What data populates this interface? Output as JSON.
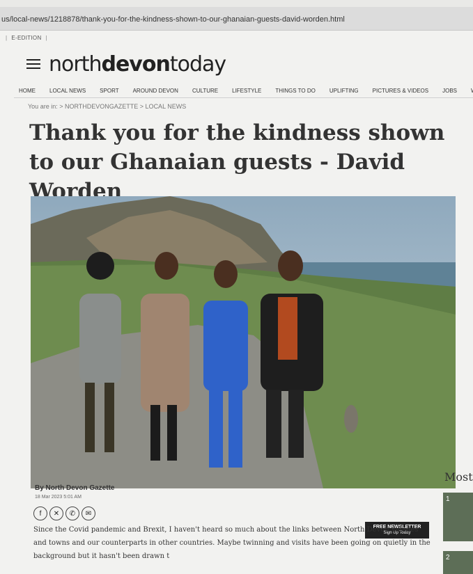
{
  "browser": {
    "url": "us/local-news/1218878/thank-you-for-the-kindness-shown-to-our-ghanaian-guests-david-worden.html"
  },
  "site": {
    "edition_label": "E-EDITION",
    "logo_light_1": "north",
    "logo_bold": "devon",
    "logo_light_2": "today"
  },
  "nav": {
    "items": [
      "HOME",
      "LOCAL NEWS",
      "SPORT",
      "AROUND DEVON",
      "CULTURE",
      "LIFESTYLE",
      "THINGS TO DO",
      "UPLIFTING",
      "PICTURES & VIDEOS",
      "JOBS",
      "WI"
    ]
  },
  "breadcrumb": "You are in: > NORTHDEVONGAZETTE > LOCAL NEWS",
  "article": {
    "headline": "Thank you for the kindness shown to our Ghanaian guests - David Worden",
    "byline": "By North Devon Gazette",
    "date": "18 Mar 2023 5:01 AM",
    "body": "Since the Covid pandemic and Brexit, I haven't heard so much about the links between North Devon villages and towns and our counterparts in other countries. Maybe twinning and visits have been going on quietly in the background but it hasn't been drawn t"
  },
  "newsletter": {
    "title": "FREE NEWSLETTER",
    "sub": "Sign Up Today"
  },
  "sidebar": {
    "most_title": "Most",
    "ranks": [
      "1",
      "2"
    ]
  },
  "colors": {
    "sky": "#9fb6c9",
    "grass": "#5f7d45",
    "newsletter_bg": "#222222"
  }
}
